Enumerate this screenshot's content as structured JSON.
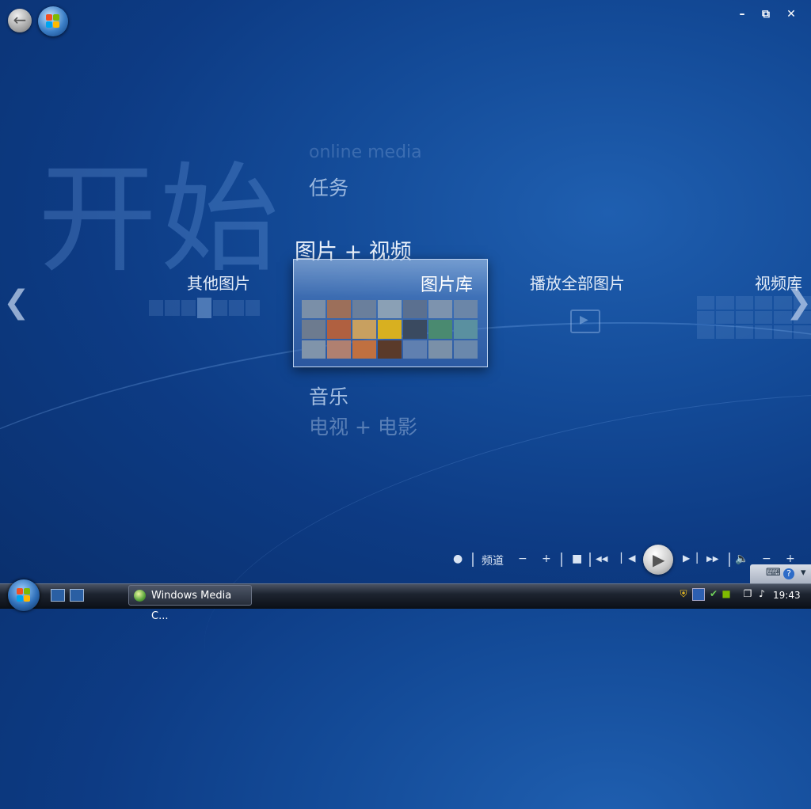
{
  "window": {
    "minimize_glyph": "–",
    "restore_glyph": "⧉",
    "close_glyph": "✕"
  },
  "header": {
    "back_icon": "back-arrow-icon",
    "logo_icon": "windows-start-orb-icon"
  },
  "page": {
    "title": "开始"
  },
  "menu": {
    "above_ghost": "online media",
    "tasks": "任务",
    "current": "图片 + 视频",
    "music": "音乐",
    "tv": "电视 + 电影"
  },
  "strip": {
    "items": [
      {
        "label": "其他图片"
      },
      {
        "label": "图片库",
        "selected": true
      },
      {
        "label": "播放全部图片"
      },
      {
        "label": "视频库"
      }
    ],
    "prev_glyph": "❮",
    "next_glyph": "❯"
  },
  "transport": {
    "record_glyph": "●",
    "channel_label": "频道",
    "ch_minus": "−",
    "ch_plus": "+",
    "stop_glyph": "■",
    "rewind_glyph": "◀◀",
    "prev_glyph": "▏◀",
    "play_glyph": "▶",
    "next_glyph": "▶▕",
    "ffwd_glyph": "▶▶",
    "mute_glyph": "🔈",
    "vol_minus": "−",
    "vol_plus": "+"
  },
  "mini_bar": {
    "keyboard_glyph": "⌨",
    "help_glyph": "?",
    "menu_glyph": "▾"
  },
  "taskbar": {
    "task_label": "Windows Media C...",
    "clock": "19:43"
  },
  "colors": {
    "background": "#0d3b84",
    "accent": "#1f5fb0",
    "taskbar": "#1d2430"
  }
}
